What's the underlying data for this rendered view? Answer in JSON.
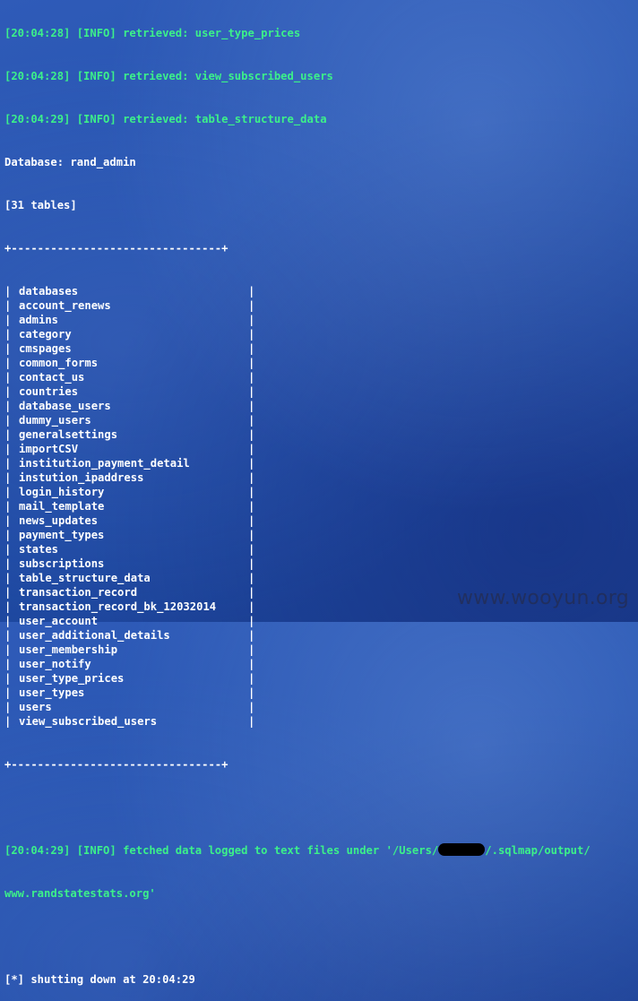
{
  "log_top": [
    "[20:04:28] [INFO] retrieved: user_type_prices",
    "[20:04:28] [INFO] retrieved: view_subscribed_users",
    "[20:04:29] [INFO] retrieved: table_structure_data"
  ],
  "database_line": "Database: rand_admin",
  "tables_count": "[31 tables]",
  "border": "+--------------------------------+",
  "pipe": "|",
  "tables": [
    "databases",
    "account_renews",
    "admins",
    "category",
    "cmspages",
    "common_forms",
    "contact_us",
    "countries",
    "database_users",
    "dummy_users",
    "generalsettings",
    "importCSV",
    "institution_payment_detail",
    "instution_ipaddress",
    "login_history",
    "mail_template",
    "news_updates",
    "payment_types",
    "states",
    "subscriptions",
    "table_structure_data",
    "transaction_record",
    "transaction_record_bk_12032014",
    "user_account",
    "user_additional_details",
    "user_membership",
    "user_notify",
    "user_type_prices",
    "user_types",
    "users",
    "view_subscribed_users"
  ],
  "fetched": {
    "prefix": "[20:04:29] [INFO] fetched data logged to text files under '/Users/",
    "suffix": "/.sqlmap/output/",
    "continuation": "www.randstatestats.org'"
  },
  "shutdown": "[*] shutting down at 20:04:29",
  "watermark": "www.wooyun.org"
}
